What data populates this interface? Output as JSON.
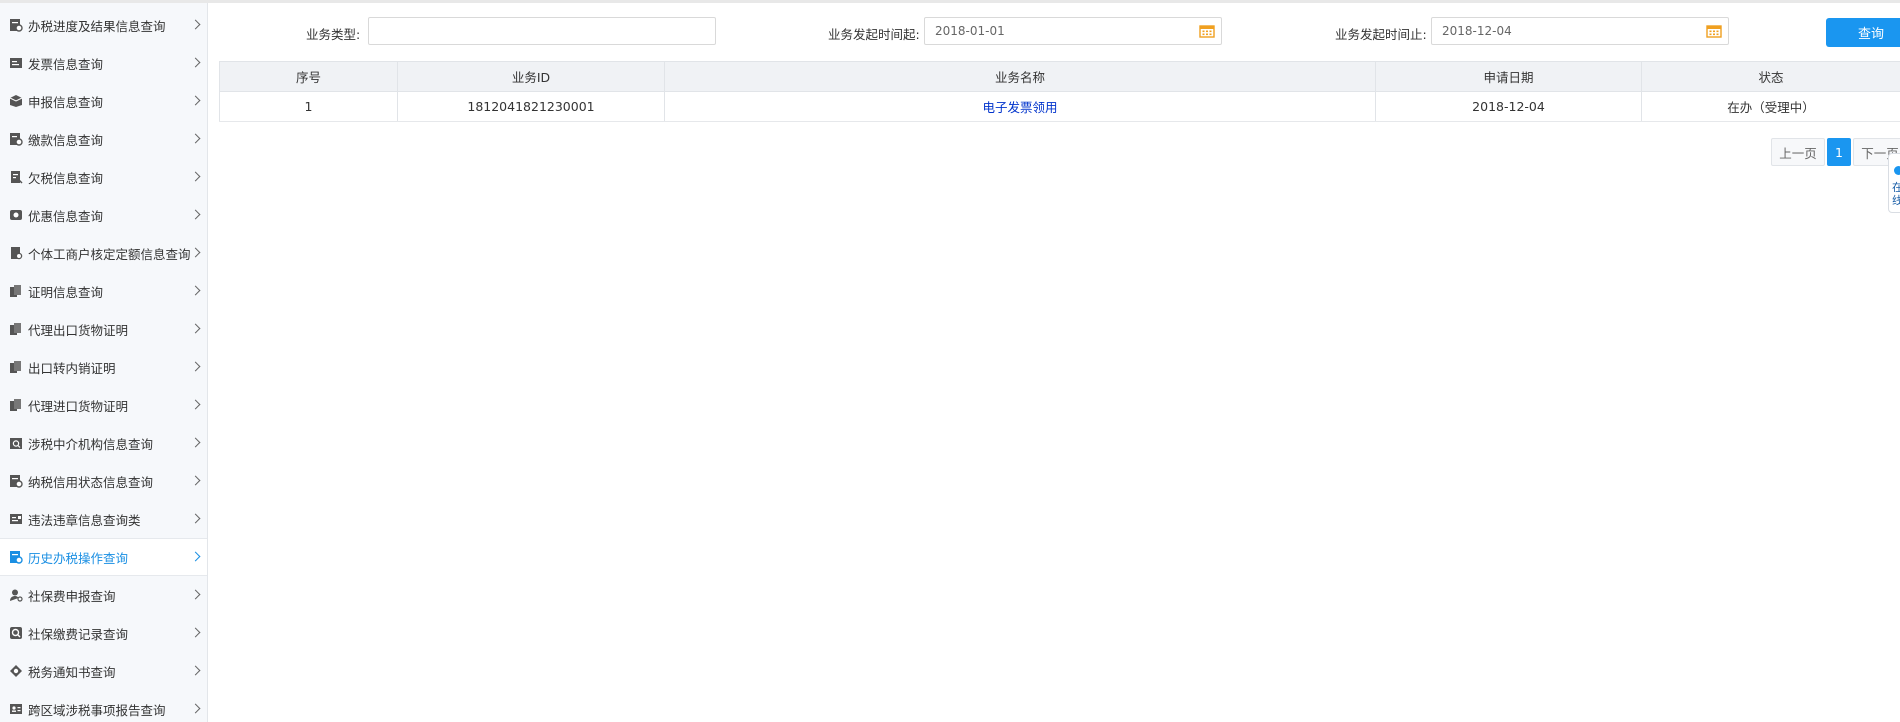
{
  "sidebar": {
    "items": [
      {
        "label": "办税进度及结果信息查询",
        "icon": "progress-doc-icon"
      },
      {
        "label": "发票信息查询",
        "icon": "invoice-icon"
      },
      {
        "label": "申报信息查询",
        "icon": "declaration-box-icon"
      },
      {
        "label": "缴款信息查询",
        "icon": "payment-doc-icon"
      },
      {
        "label": "欠税信息查询",
        "icon": "arrears-doc-icon"
      },
      {
        "label": "优惠信息查询",
        "icon": "discount-icon"
      },
      {
        "label": "个体工商户核定定额信息查询",
        "icon": "quota-doc-icon"
      },
      {
        "label": "证明信息查询",
        "icon": "certificate-icon"
      },
      {
        "label": "代理出口货物证明",
        "icon": "export-cert-icon"
      },
      {
        "label": "出口转内销证明",
        "icon": "domestic-sale-cert-icon"
      },
      {
        "label": "代理进口货物证明",
        "icon": "import-cert-icon"
      },
      {
        "label": "涉税中介机构信息查询",
        "icon": "agency-search-icon"
      },
      {
        "label": "纳税信用状态信息查询",
        "icon": "credit-status-icon"
      },
      {
        "label": "违法违章信息查询类",
        "icon": "violation-icon"
      },
      {
        "label": "历史办税操作查询",
        "icon": "history-search-icon",
        "active": true
      },
      {
        "label": "社保费申报查询",
        "icon": "user-search-icon"
      },
      {
        "label": "社保缴费记录查询",
        "icon": "magnifier-icon"
      },
      {
        "label": "税务通知书查询",
        "icon": "notice-eye-icon"
      },
      {
        "label": "跨区域涉税事项报告查询",
        "icon": "id-card-icon"
      }
    ]
  },
  "search": {
    "type_label": "业务类型:",
    "type_value": "",
    "start_label": "业务发起时间起:",
    "start_value": "2018-01-01",
    "end_label": "业务发起时间止:",
    "end_value": "2018-12-04",
    "query_button": "查询"
  },
  "table": {
    "headers": [
      "序号",
      "业务ID",
      "业务名称",
      "申请日期",
      "状态"
    ],
    "rows": [
      [
        "1",
        "1812041821230001",
        "电子发票领用",
        "2018-12-04",
        "在办（受理中）"
      ]
    ]
  },
  "pager": {
    "prev": "上一页",
    "current": "1",
    "next": "下一页"
  },
  "float_widget": {
    "text": "在线"
  },
  "colors": {
    "accent": "#1a96f0",
    "active_menu": "#1a8fe3",
    "link": "#0033cc",
    "calendar": "#f0a020"
  }
}
